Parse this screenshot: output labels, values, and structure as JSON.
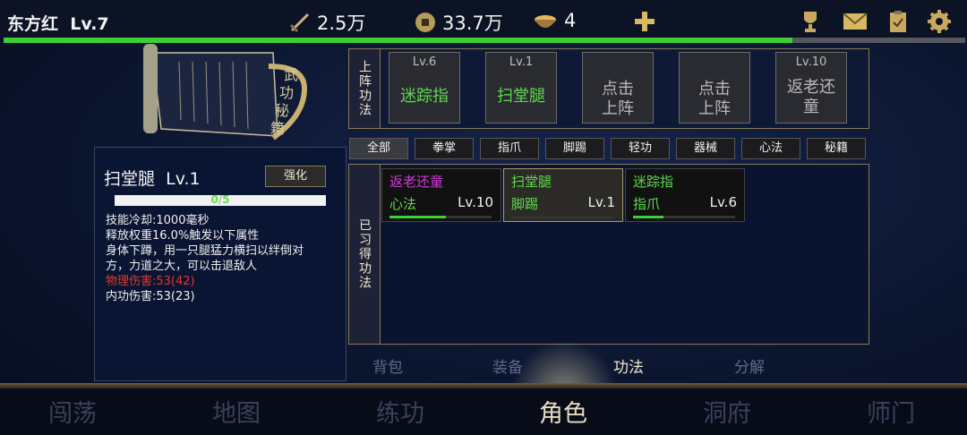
{
  "player": {
    "name": "东方红",
    "level": "Lv.7",
    "xp_fraction": 0.82
  },
  "resources": {
    "power": "2.5万",
    "coins": "33.7万",
    "bowls": "4"
  },
  "left_panel": {
    "skill_name": "扫堂腿",
    "skill_level": "Lv.1",
    "enhance_label": "强化",
    "progress_text": "0/5",
    "progress_fraction": 0.0,
    "desc": [
      {
        "text": "技能冷却:1000毫秒",
        "color": "white"
      },
      {
        "text": "释放权重16.0%触发以下属性",
        "color": "white"
      },
      {
        "text": "身体下蹲，用一只腿猛力横扫以绊倒对",
        "color": "white"
      },
      {
        "text": "方，力道之大，可以击退敌人",
        "color": "white"
      },
      {
        "text": "物理伤害:53(42)",
        "color": "red"
      },
      {
        "text": "内功伤害:53(23)",
        "color": "white"
      }
    ]
  },
  "scroll_art": {
    "title": "武功秘籍"
  },
  "equipped": {
    "label": "上阵功法",
    "slots": [
      {
        "level": "Lv.6",
        "name": "迷踪指",
        "color": "#5fd84f"
      },
      {
        "level": "Lv.1",
        "name": "扫堂腿",
        "color": "#5fd84f"
      },
      {
        "empty_line1": "点击",
        "empty_line2": "上阵"
      },
      {
        "empty_line1": "点击",
        "empty_line2": "上阵"
      },
      {
        "level": "Lv.10",
        "name": "返老还童",
        "name_line1": "返老还",
        "name_line2": "童",
        "color": "#d13ad6"
      }
    ]
  },
  "tabs": [
    "全部",
    "拳掌",
    "指爪",
    "脚踢",
    "轻功",
    "器械",
    "心法",
    "秘籍"
  ],
  "learned": {
    "label": "已习得功法",
    "items": [
      {
        "name": "返老还童",
        "category": "心法",
        "level": "Lv.10",
        "color": "#d13ad6",
        "progress": 0.55
      },
      {
        "name": "扫堂腿",
        "category": "脚踢",
        "level": "Lv.1",
        "color": "#5fd84f",
        "progress": 0.0
      },
      {
        "name": "迷踪指",
        "category": "指爪",
        "level": "Lv.6",
        "color": "#5fd84f",
        "progress": 0.3
      }
    ]
  },
  "subnav": [
    "背包",
    "装备",
    "功法",
    "分解"
  ],
  "bottomnav": [
    "闯荡",
    "地图",
    "练功",
    "角色",
    "洞府",
    "师门"
  ],
  "icons": [
    "sword-icon",
    "coin-icon",
    "bowl-icon",
    "plus-icon",
    "trophy-icon",
    "mail-icon",
    "clipboard-icon",
    "gear-icon"
  ]
}
